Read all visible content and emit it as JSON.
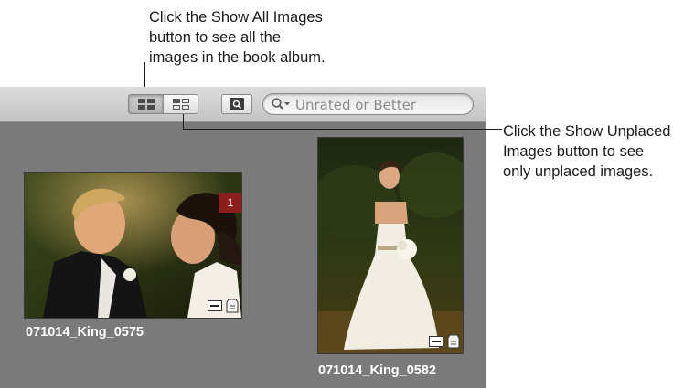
{
  "callouts": {
    "show_all": [
      "Click the Show All Images",
      "button to see all the",
      "images in the book album."
    ],
    "show_unplaced": [
      "Click the Show Unplaced",
      "Images button to see",
      "only unplaced images."
    ]
  },
  "toolbar": {
    "search": {
      "value": "Unrated or Better"
    }
  },
  "images": [
    {
      "name": "071014_King_0575",
      "count_badge": "1"
    },
    {
      "name": "071014_King_0582"
    }
  ],
  "icons": {
    "show_all": "grid-icon",
    "show_unplaced": "unplaced-grid-icon",
    "view": "magnifier-square-icon",
    "search": "search-icon",
    "placed": "placed-icon",
    "metadata": "tag-icon"
  },
  "colors": {
    "panel_background": "#7a7a7a",
    "badge": "#8e1d1d"
  }
}
